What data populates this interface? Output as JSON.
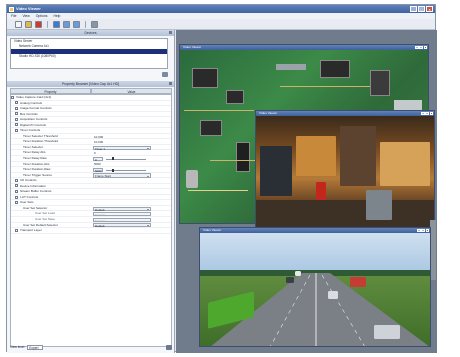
{
  "app": {
    "title": "Video Viewer",
    "window_buttons": [
      "_",
      "□",
      "×"
    ]
  },
  "menu": [
    "File",
    "View",
    "Options",
    "Help"
  ],
  "toolbar": {
    "icons": [
      {
        "name": "new-icon",
        "color": "#f5f5f5"
      },
      {
        "name": "open-icon",
        "color": "#e1b84a"
      },
      {
        "name": "record-icon",
        "color": "#d23a2a"
      },
      {
        "name": "play-icon",
        "color": "#3a7bd5"
      },
      {
        "name": "zoom-in-icon",
        "color": "#6b9cd8"
      },
      {
        "name": "zoom-out-icon",
        "color": "#6b9cd8"
      },
      {
        "name": "settings-icon",
        "color": "#8a96a6"
      }
    ]
  },
  "devices": {
    "title": "Devices",
    "items": [
      {
        "label": "Video Server",
        "selected": false
      },
      {
        "label": "Network Camera 4x1",
        "selected": false
      },
      {
        "label": "",
        "selected": true
      },
      {
        "label": "Studio HD-SDI (1080P60)",
        "selected": false
      }
    ]
  },
  "properties": {
    "title": "Property Browser [Video Cap 4x1 HD]",
    "columns": [
      "Property",
      "Value"
    ],
    "rows": [
      {
        "label": "Video Capture Card (4x1)",
        "level": 0,
        "expander": true
      },
      {
        "label": "Analog Controls",
        "level": 1,
        "expander": true
      },
      {
        "label": "Image Format Controls",
        "level": 1,
        "expander": true
      },
      {
        "label": "Bus Controls",
        "level": 1,
        "expander": true
      },
      {
        "label": "Acquisition Controls",
        "level": 1,
        "expander": true
      },
      {
        "label": "Digital I/O Controls",
        "level": 1,
        "expander": true
      },
      {
        "label": "Timer Controls",
        "level": 1,
        "expander": true
      },
      {
        "label": "Timer Selector Threshold",
        "level": 2,
        "value": "10,000",
        "vtype": "text"
      },
      {
        "label": "Timer Duration Threshold",
        "level": 2,
        "value": "10,000",
        "vtype": "text"
      },
      {
        "label": "Timer Selector",
        "level": 2,
        "value": "Timer 1",
        "vtype": "dd"
      },
      {
        "label": "Timer Delay Abs",
        "level": 2,
        "value": "0",
        "vtype": "text"
      },
      {
        "label": "Timer Delay Raw",
        "level": 2,
        "value": "0",
        "vtype": "slider"
      },
      {
        "label": "Timer Duration Abs",
        "level": 2,
        "value": "5000",
        "vtype": "text"
      },
      {
        "label": "Timer Duration Raw",
        "level": 2,
        "value": "5000",
        "vtype": "slider"
      },
      {
        "label": "Timer Trigger Source",
        "level": 2,
        "value": "Frame Start",
        "vtype": "dd"
      },
      {
        "label": "I/O Controls",
        "level": 1,
        "expander": true
      },
      {
        "label": "Device Information",
        "level": 1,
        "expander": true
      },
      {
        "label": "Stream Buffer Controls",
        "level": 1,
        "expander": true
      },
      {
        "label": "LUT Controls",
        "level": 1,
        "expander": true
      },
      {
        "label": "User Sets",
        "level": 1,
        "expander": true
      },
      {
        "label": "User Set Selector",
        "level": 2,
        "value": "Default",
        "vtype": "dd"
      },
      {
        "label": "User Set Load",
        "level": 3,
        "value": "Execute",
        "vtype": "dis"
      },
      {
        "label": "User Set Save",
        "level": 3,
        "value": "Execute",
        "vtype": "dis"
      },
      {
        "label": "User Set Default Selector",
        "level": 2,
        "value": "Default",
        "vtype": "dd"
      },
      {
        "label": "Transport Layer",
        "level": 1,
        "expander": true
      }
    ]
  },
  "bottom": {
    "label": "View level",
    "selected": "Expert"
  },
  "viewers": [
    {
      "title": "Video Viewer",
      "content": "PCB inspection feed"
    },
    {
      "title": "Video Viewer",
      "content": "Factory floor feed"
    },
    {
      "title": "Video Viewer",
      "content": "Highway traffic feed"
    }
  ]
}
